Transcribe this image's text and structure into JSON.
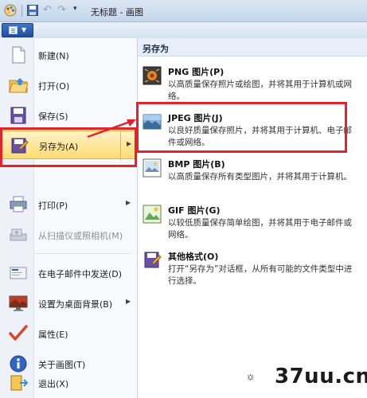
{
  "titlebar": {
    "title": "无标题 - 画图",
    "icons": [
      "paint-app-icon",
      "save-icon",
      "undo-icon",
      "redo-icon",
      "customize-dropdown-icon"
    ]
  },
  "app_menu_button": {
    "icon": "paint-document-icon"
  },
  "left_menu": {
    "items": [
      {
        "label": "新建(N)",
        "icon": "new-document-icon"
      },
      {
        "label": "打开(O)",
        "icon": "open-folder-icon"
      },
      {
        "label": "保存(S)",
        "icon": "save-disk-icon"
      },
      {
        "label": "另存为(A)",
        "icon": "save-as-icon",
        "has_submenu": true,
        "highlighted": true
      },
      {
        "label": "打印(P)",
        "icon": "printer-icon",
        "has_submenu": true
      },
      {
        "label": "从扫描仪或照相机(M)",
        "icon": "scanner-icon",
        "disabled": true
      },
      {
        "label": "在电子邮件中发送(D)",
        "icon": "email-icon"
      },
      {
        "label": "设置为桌面背景(B)",
        "icon": "desktop-background-icon",
        "has_submenu": true
      },
      {
        "label": "属性(E)",
        "icon": "properties-check-icon"
      },
      {
        "label": "关于画图(T)",
        "icon": "info-icon"
      },
      {
        "label": "退出(X)",
        "icon": "exit-icon"
      }
    ]
  },
  "submenu": {
    "title": "另存为",
    "items": [
      {
        "name": "PNG 图片(P)",
        "desc": "以高质量保存照片或绘图，并将其用于计算机或网络。",
        "icon": "png-image-icon"
      },
      {
        "name": "JPEG 图片(J)",
        "desc": "以良好质量保存照片，并将其用于计算机、电子邮件或网络。",
        "icon": "jpeg-image-icon",
        "emphasized": true
      },
      {
        "name": "BMP 图片(B)",
        "desc": "以高质量保存所有类型图片，并将其用于计算机。",
        "icon": "bmp-image-icon"
      },
      {
        "name": "GIF 图片(G)",
        "desc": "以较低质量保存简单绘图，并将其用于电子邮件或网络。",
        "icon": "gif-image-icon"
      },
      {
        "name": "其他格式(O)",
        "desc": "打开“另存为”对话框，从所有可能的文件类型中进行选择。",
        "icon": "other-formats-icon"
      }
    ]
  },
  "watermark": {
    "text": "37uu.cn",
    "icon": "watermark-sun-logo"
  },
  "colors": {
    "highlight": "#fddc72",
    "annotation_red": "#e3222a",
    "ribbon": "#d7e3f2"
  }
}
